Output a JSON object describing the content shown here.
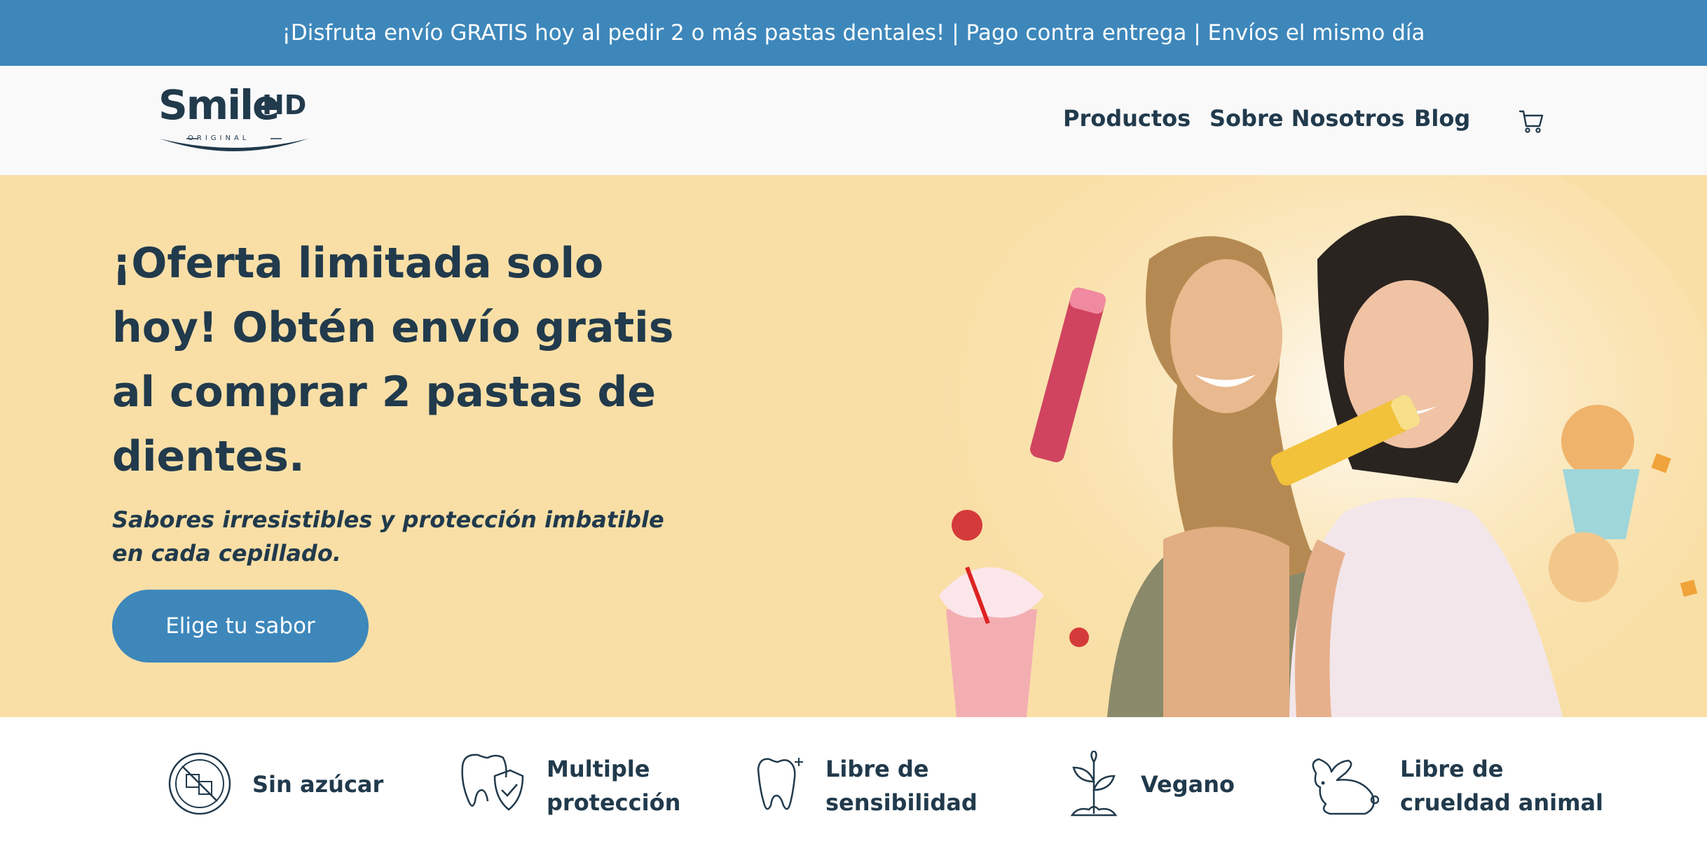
{
  "announcement": {
    "text": "¡Disfruta envío GRATIS hoy al pedir 2 o más pastas dentales! | Pago contra entrega | Envíos el mismo día"
  },
  "header": {
    "logo": {
      "word": "Smile",
      "suffix": "HD",
      "tagline": "ORIGINAL"
    },
    "nav": [
      "Productos",
      "Sobre Nosotros",
      "Blog"
    ],
    "cart_icon": "shopping-cart-icon"
  },
  "hero": {
    "headline": "¡Oferta limitada solo hoy! Obtén envío gratis al comprar 2 pastas de dientes.",
    "subline": "Sabores irresistibles y protección imbatible en cada cepillado.",
    "cta_label": "Elige tu sabor",
    "background_color": "#f9dfa6"
  },
  "features": [
    {
      "icon": "no-sugar-icon",
      "label": "Sin azúcar"
    },
    {
      "icon": "tooth-shield-icon",
      "label": "Multiple protección"
    },
    {
      "icon": "tooth-sparkle-icon",
      "label": "Libre de sensibilidad"
    },
    {
      "icon": "sprout-icon",
      "label": "Vegano"
    },
    {
      "icon": "rabbit-icon",
      "label": "Libre de crueldad animal"
    }
  ],
  "colors": {
    "accent": "#3d87bb",
    "text": "#213a4c",
    "header_bg": "#f9f9fa"
  }
}
